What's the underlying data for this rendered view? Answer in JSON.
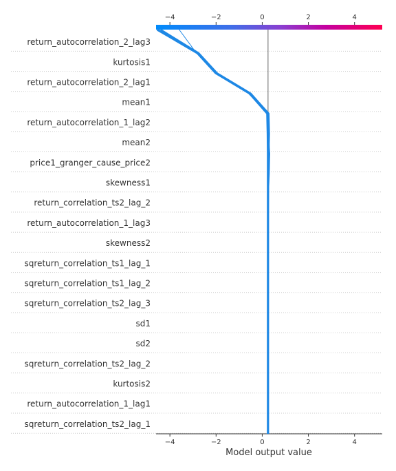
{
  "chart_data": {
    "type": "line",
    "subtype": "shap-decision-plot",
    "title": "",
    "xlabel": "Model output value",
    "ylabel": "",
    "xlim": [
      -4.6,
      5.2
    ],
    "x_ticks": [
      -4,
      -2,
      0,
      2,
      4
    ],
    "base_value": 0.25,
    "features": [
      "return_autocorrelation_2_lag3",
      "kurtosis1",
      "return_autocorrelation_2_lag1",
      "mean1",
      "return_autocorrelation_1_lag2",
      "mean2",
      "price1_granger_cause_price2",
      "skewness1",
      "return_correlation_ts2_lag_2",
      "return_autocorrelation_1_lag3",
      "skewness2",
      "sqreturn_correlation_ts1_lag_1",
      "sqreturn_correlation_ts1_lag_2",
      "sqreturn_correlation_ts2_lag_3",
      "sd1",
      "sd2",
      "sqreturn_correlation_ts2_lag_2",
      "kurtosis2",
      "return_autocorrelation_1_lag1",
      "sqreturn_correlation_ts2_lag_1"
    ],
    "series": [
      {
        "values": [
          -4.55,
          -2.8,
          -2.0,
          -0.55,
          0.22,
          0.24,
          0.25,
          0.25,
          0.25,
          0.25,
          0.25,
          0.25,
          0.25,
          0.25,
          0.25,
          0.25,
          0.25,
          0.25,
          0.25,
          0.25,
          0.25
        ],
        "width": 3.2
      },
      {
        "values": [
          -4.4,
          -2.75,
          -1.95,
          -0.5,
          0.28,
          0.3,
          0.28,
          0.27,
          0.26,
          0.25,
          0.25,
          0.25,
          0.25,
          0.25,
          0.25,
          0.25,
          0.25,
          0.25,
          0.25,
          0.25,
          0.25
        ],
        "width": 2.4
      },
      {
        "values": [
          -3.6,
          -2.85,
          -2.05,
          -0.6,
          0.25,
          0.27,
          0.33,
          0.31,
          0.27,
          0.25,
          0.25,
          0.25,
          0.25,
          0.25,
          0.25,
          0.25,
          0.25,
          0.25,
          0.25,
          0.25,
          0.25
        ],
        "width": 1.0
      }
    ],
    "colormap": [
      "#008bfb",
      "#8a3fd1",
      "#c4009f",
      "#ff0052"
    ],
    "line_color": "#1e88e5",
    "base_line_color": "#999999",
    "grid": "dotted horizontal"
  }
}
